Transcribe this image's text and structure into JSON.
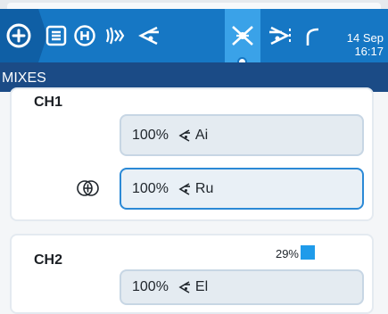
{
  "datetime": {
    "date": "14 Sep",
    "time": "16:17"
  },
  "toolbar": {
    "icons": [
      "plus-circle-icon",
      "list-icon",
      "h-circle-icon",
      "wave-icon",
      "input-icon",
      "mixer-icon",
      "output-icon",
      "curve-icon"
    ],
    "active": "mixer-icon",
    "colors": {
      "bar": "#1677c4",
      "home": "#0f5fa5",
      "active": "#3aa2e8"
    }
  },
  "section": {
    "title": "MIXES"
  },
  "channels": [
    {
      "label": "CH1",
      "mixes": [
        {
          "weight": "100%",
          "source": "Ai",
          "icon": "input-icon"
        },
        {
          "weight": "100%",
          "source": "Ru",
          "icon": "input-icon",
          "selected": true,
          "multiplex_icon": "add-circle-icon"
        }
      ]
    },
    {
      "label": "CH2",
      "output_percent": "29%",
      "bar_color": "#1f9bea",
      "mixes": [
        {
          "weight": "100%",
          "source": "El",
          "icon": "input-icon"
        }
      ]
    }
  ]
}
